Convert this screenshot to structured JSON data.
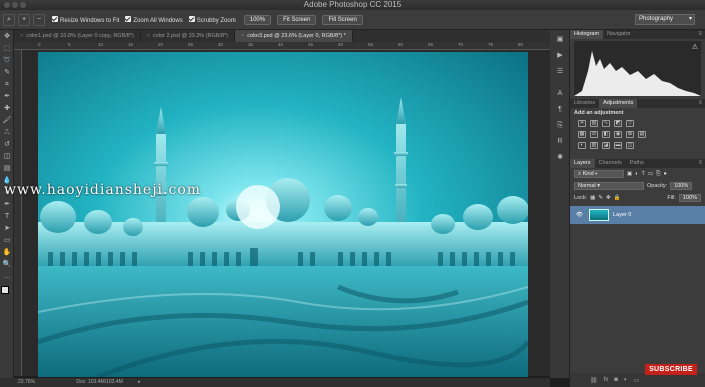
{
  "window": {
    "title": "Adobe Photoshop CC 2015"
  },
  "options_bar": {
    "resize_windows": "Resize Windows to Fit",
    "zoom_all_windows": "Zoom All Windows",
    "scrubby_zoom": "Scrubby Zoom",
    "zoom_percent": "100%",
    "fit_screen": "Fit Screen",
    "fill_screen": "Fill Screen",
    "workspace": "Photography"
  },
  "tabs": [
    {
      "label": "color1.psd @ 33.8% (Layer 0 copy, RGB/8*)"
    },
    {
      "label": "color 2.psd @ 33.3% (RGB/8*)"
    },
    {
      "label": "color3.psd @ 23.6% (Layer 0, RGB/8*) *"
    }
  ],
  "rulers": {
    "top_marks": [
      "0",
      "5",
      "10",
      "15",
      "20",
      "25",
      "30",
      "35",
      "40",
      "45",
      "50",
      "55",
      "60",
      "65",
      "70",
      "75",
      "80"
    ]
  },
  "canvas": {
    "watermark": "www.haoyidiansheji.com"
  },
  "status": {
    "zoom": "23.76%",
    "doc": "Doc: 103.4M/103.4M"
  },
  "panels": {
    "histogram_tabs": [
      "Histogram",
      "Navigator"
    ],
    "adj_tabs": [
      "Libraries",
      "Adjustments"
    ],
    "adj_title": "Add an adjustment",
    "layer_tabs": [
      "Layers",
      "Channels",
      "Paths"
    ],
    "kind": "Kind",
    "blend_mode": "Normal",
    "opacity_label": "Opacity:",
    "opacity_value": "100%",
    "lock_label": "Lock:",
    "fill_label": "Fill:",
    "fill_value": "100%",
    "layer_name": "Layer 0"
  },
  "badge": {
    "subscribe": "SUBSCRIBE"
  },
  "colors": {
    "accent": "#5a7fa6",
    "sky_top": "#1a9aa8",
    "sky_glow": "#d9fbff"
  }
}
